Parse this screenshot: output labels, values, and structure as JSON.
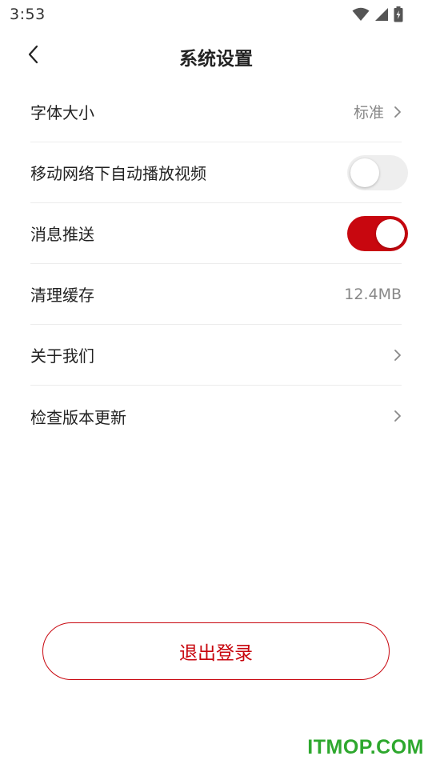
{
  "status_bar": {
    "time": "3:53",
    "icons": [
      "wifi-icon",
      "cellular-signal-icon",
      "battery-charging-icon"
    ]
  },
  "header": {
    "title": "系统设置",
    "back_icon": "chevron-left-icon"
  },
  "settings": {
    "font_size": {
      "label": "字体大小",
      "value": "标准"
    },
    "autoplay_video": {
      "label": "移动网络下自动播放视频",
      "enabled": false
    },
    "push_notifications": {
      "label": "消息推送",
      "enabled": true
    },
    "clear_cache": {
      "label": "清理缓存",
      "value": "12.4MB"
    },
    "about_us": {
      "label": "关于我们"
    },
    "check_update": {
      "label": "检查版本更新"
    }
  },
  "logout": {
    "label": "退出登录"
  },
  "watermark": {
    "text": "ITMOP.COM"
  },
  "colors": {
    "accent": "#c8070f",
    "toggle_off": "#eeeeee",
    "watermark": "#2ea82e",
    "secondary_text": "#888888"
  }
}
